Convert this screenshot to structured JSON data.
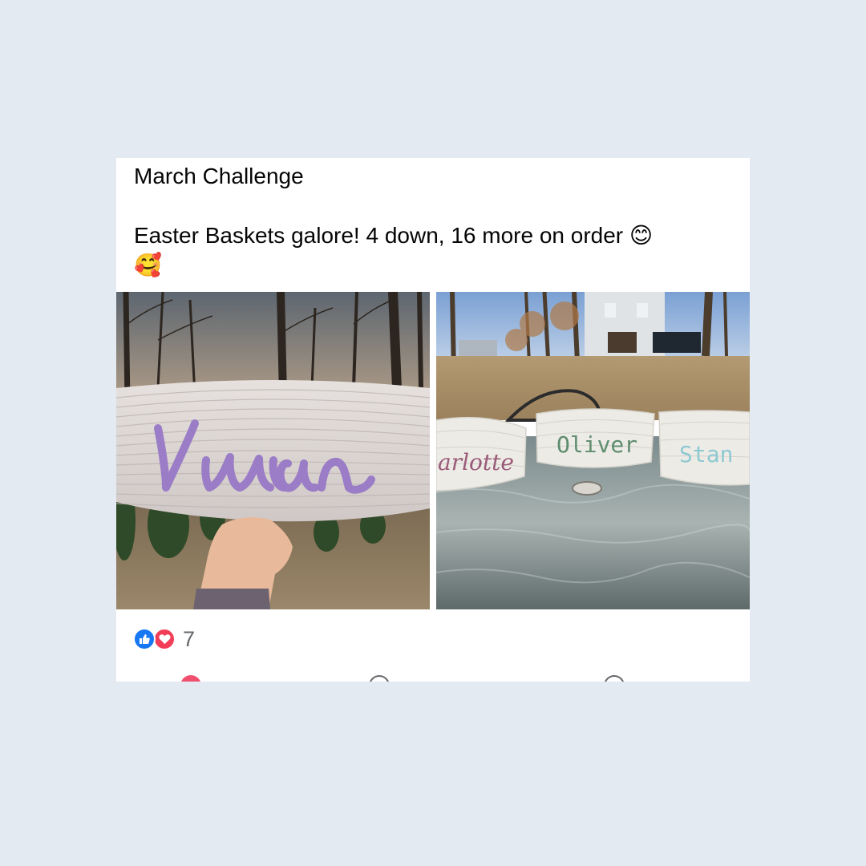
{
  "post": {
    "title": "March Challenge",
    "body": "Easter Baskets galore! 4 down, 16 more on order ",
    "body_emoji_1": "😊",
    "body_emoji_2": "🥰"
  },
  "photos": [
    {
      "alt": "Rope basket embroidered with the name Vivian held up in front of trees at sunset",
      "embroidered_name": "Vivian",
      "thread_color": "#9b7cc6"
    },
    {
      "alt": "Three rope baskets on a glass patio table embroidered with Charlotte, Oliver and Stan",
      "embroidered_names": [
        "Charlotte",
        "Oliver",
        "Stan"
      ],
      "visible_fragments": [
        "arlotte",
        "Oliver",
        "Stan"
      ],
      "thread_colors": [
        "#9a5a78",
        "#5f8d6e",
        "#8fc9d2"
      ]
    }
  ],
  "reactions": {
    "count": "7",
    "icons": [
      "like-icon",
      "love-icon"
    ],
    "colors": {
      "like": "#1877f2",
      "love": "#f33e58"
    }
  }
}
